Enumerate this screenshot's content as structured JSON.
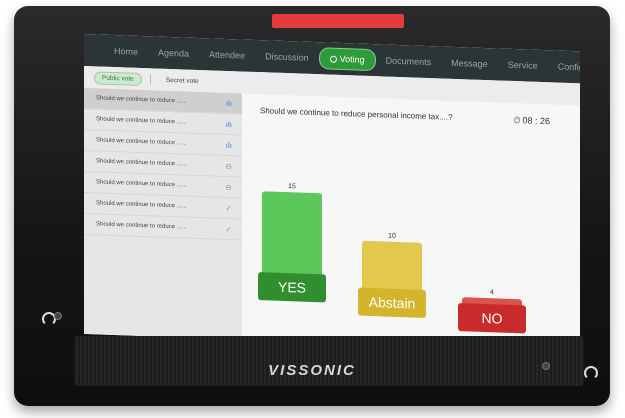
{
  "device": {
    "brand": "VISSONIC"
  },
  "nav": {
    "items": [
      {
        "label": "Home",
        "active": false
      },
      {
        "label": "Agenda",
        "active": false
      },
      {
        "label": "Attendee",
        "active": false
      },
      {
        "label": "Discussion",
        "active": false
      },
      {
        "label": "Voting",
        "active": true
      },
      {
        "label": "Documents",
        "active": false
      },
      {
        "label": "Message",
        "active": false
      },
      {
        "label": "Service",
        "active": false
      },
      {
        "label": "Configuration",
        "active": false
      }
    ]
  },
  "vote_tabs": {
    "public": "Public vote",
    "secret": "Secret vote"
  },
  "sidebar": {
    "items": [
      {
        "label": "Should we continue to reduce ......",
        "icon": "bar-chart-icon",
        "glyph": "ılı"
      },
      {
        "label": "Should we continue to reduce ......",
        "icon": "bar-chart-icon",
        "glyph": "ılı"
      },
      {
        "label": "Should we continue to reduce ......",
        "icon": "bar-chart-icon",
        "glyph": "ılı"
      },
      {
        "label": "Should we continue to reduce ......",
        "icon": "pending-icon",
        "glyph": "⊖"
      },
      {
        "label": "Should we continue to reduce ......",
        "icon": "pending-icon",
        "glyph": "⊖"
      },
      {
        "label": "Should we continue to reduce ......",
        "icon": "check-icon",
        "glyph": "✓"
      },
      {
        "label": "Should we continue to reduce ......",
        "icon": "check-icon",
        "glyph": "✓"
      }
    ]
  },
  "main": {
    "question": "Should we continue to reduce personal income tax....?",
    "timer": "08 : 26"
  },
  "chart_data": {
    "type": "bar",
    "categories": [
      "YES",
      "Abstain",
      "NO"
    ],
    "values": [
      15,
      10,
      4
    ],
    "colors": [
      "#5cc85c",
      "#e2c94e",
      "#d9534f"
    ],
    "label_colors": [
      "#2f8f2f",
      "#d4b42a",
      "#c92a2a"
    ],
    "ylim": [
      0,
      16
    ]
  }
}
